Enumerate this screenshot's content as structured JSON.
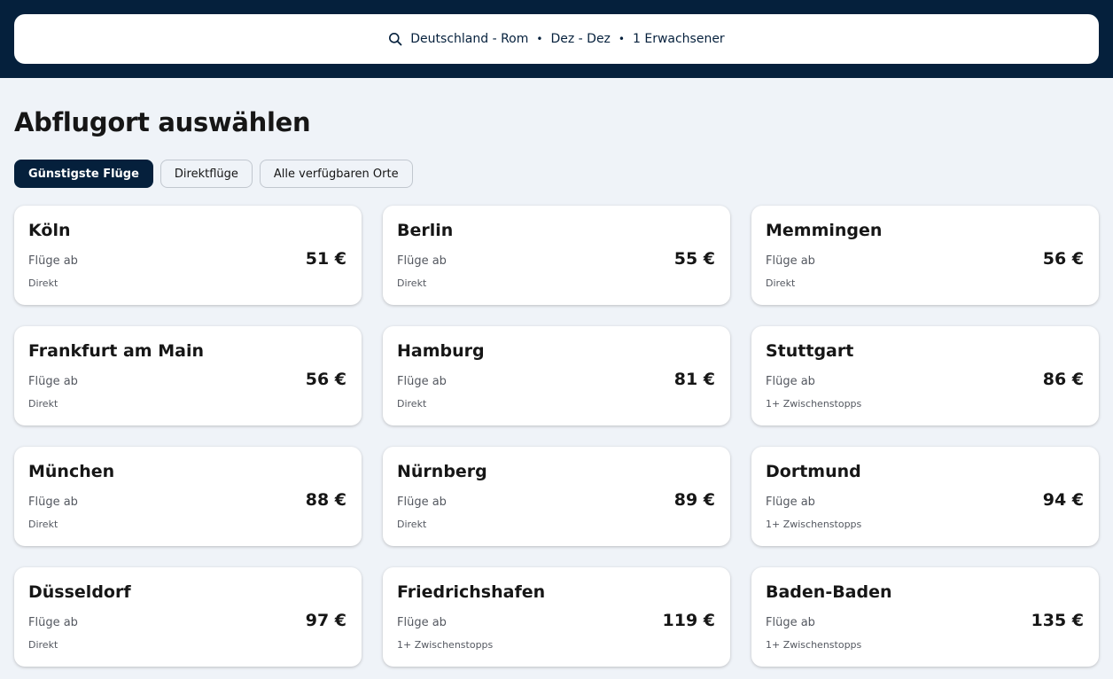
{
  "search": {
    "route": "Deutschland - Rom",
    "dates": "Dez - Dez",
    "passengers": "1 Erwachsener",
    "separator": "•"
  },
  "page": {
    "title": "Abflugort auswählen"
  },
  "filters": [
    {
      "label": "Günstigste Flüge",
      "active": true
    },
    {
      "label": "Direktflüge",
      "active": false
    },
    {
      "label": "Alle verfügbaren Orte",
      "active": false
    }
  ],
  "results": [
    {
      "city": "Köln",
      "from_label": "Flüge ab",
      "price": "51 €",
      "stops": "Direkt"
    },
    {
      "city": "Berlin",
      "from_label": "Flüge ab",
      "price": "55 €",
      "stops": "Direkt"
    },
    {
      "city": "Memmingen",
      "from_label": "Flüge ab",
      "price": "56 €",
      "stops": "Direkt"
    },
    {
      "city": "Frankfurt am Main",
      "from_label": "Flüge ab",
      "price": "56 €",
      "stops": "Direkt"
    },
    {
      "city": "Hamburg",
      "from_label": "Flüge ab",
      "price": "81 €",
      "stops": "Direkt"
    },
    {
      "city": "Stuttgart",
      "from_label": "Flüge ab",
      "price": "86 €",
      "stops": "1+ Zwischenstopps"
    },
    {
      "city": "München",
      "from_label": "Flüge ab",
      "price": "88 €",
      "stops": "Direkt"
    },
    {
      "city": "Nürnberg",
      "from_label": "Flüge ab",
      "price": "89 €",
      "stops": "Direkt"
    },
    {
      "city": "Dortmund",
      "from_label": "Flüge ab",
      "price": "94 €",
      "stops": "1+ Zwischenstopps"
    },
    {
      "city": "Düsseldorf",
      "from_label": "Flüge ab",
      "price": "97 €",
      "stops": "Direkt"
    },
    {
      "city": "Friedrichshafen",
      "from_label": "Flüge ab",
      "price": "119 €",
      "stops": "1+ Zwischenstopps"
    },
    {
      "city": "Baden-Baden",
      "from_label": "Flüge ab",
      "price": "135 €",
      "stops": "1+ Zwischenstopps"
    }
  ],
  "colors": {
    "navy": "#05203c",
    "background": "#eff3f8",
    "card": "#ffffff"
  },
  "icons": {
    "search": "search-icon"
  }
}
